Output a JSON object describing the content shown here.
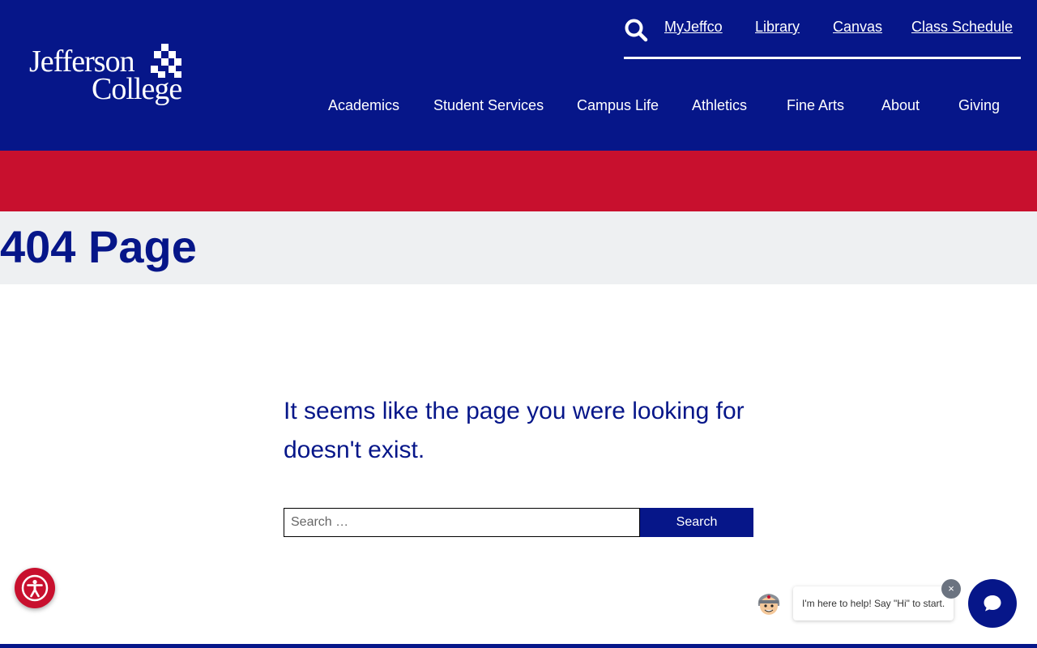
{
  "header": {
    "logo": {
      "line1": "Jefferson",
      "line2": "College"
    },
    "search_icon": "search-icon",
    "utility_links": [
      "MyJeffco",
      "Library",
      "Canvas",
      "Class Schedule"
    ],
    "main_nav": [
      "Academics",
      "Student Services",
      "Campus Life",
      "Athletics",
      "Fine Arts",
      "About",
      "Giving"
    ]
  },
  "page": {
    "title": "404 Page",
    "message": "It seems like the page you were looking for doesn't exist."
  },
  "search": {
    "placeholder": "Search …",
    "value": "",
    "button_label": "Search"
  },
  "chat": {
    "message": "I'm here to help! Say \"Hi\" to start.",
    "close_glyph": "×",
    "launcher_icon": "chat-bubble-icon",
    "avatar_icon": "bot-avatar-icon"
  },
  "accessibility": {
    "icon": "accessibility-icon"
  },
  "colors": {
    "primary_blue": "#061689",
    "accent_red": "#c8102e",
    "title_band": "#eef0f2"
  }
}
